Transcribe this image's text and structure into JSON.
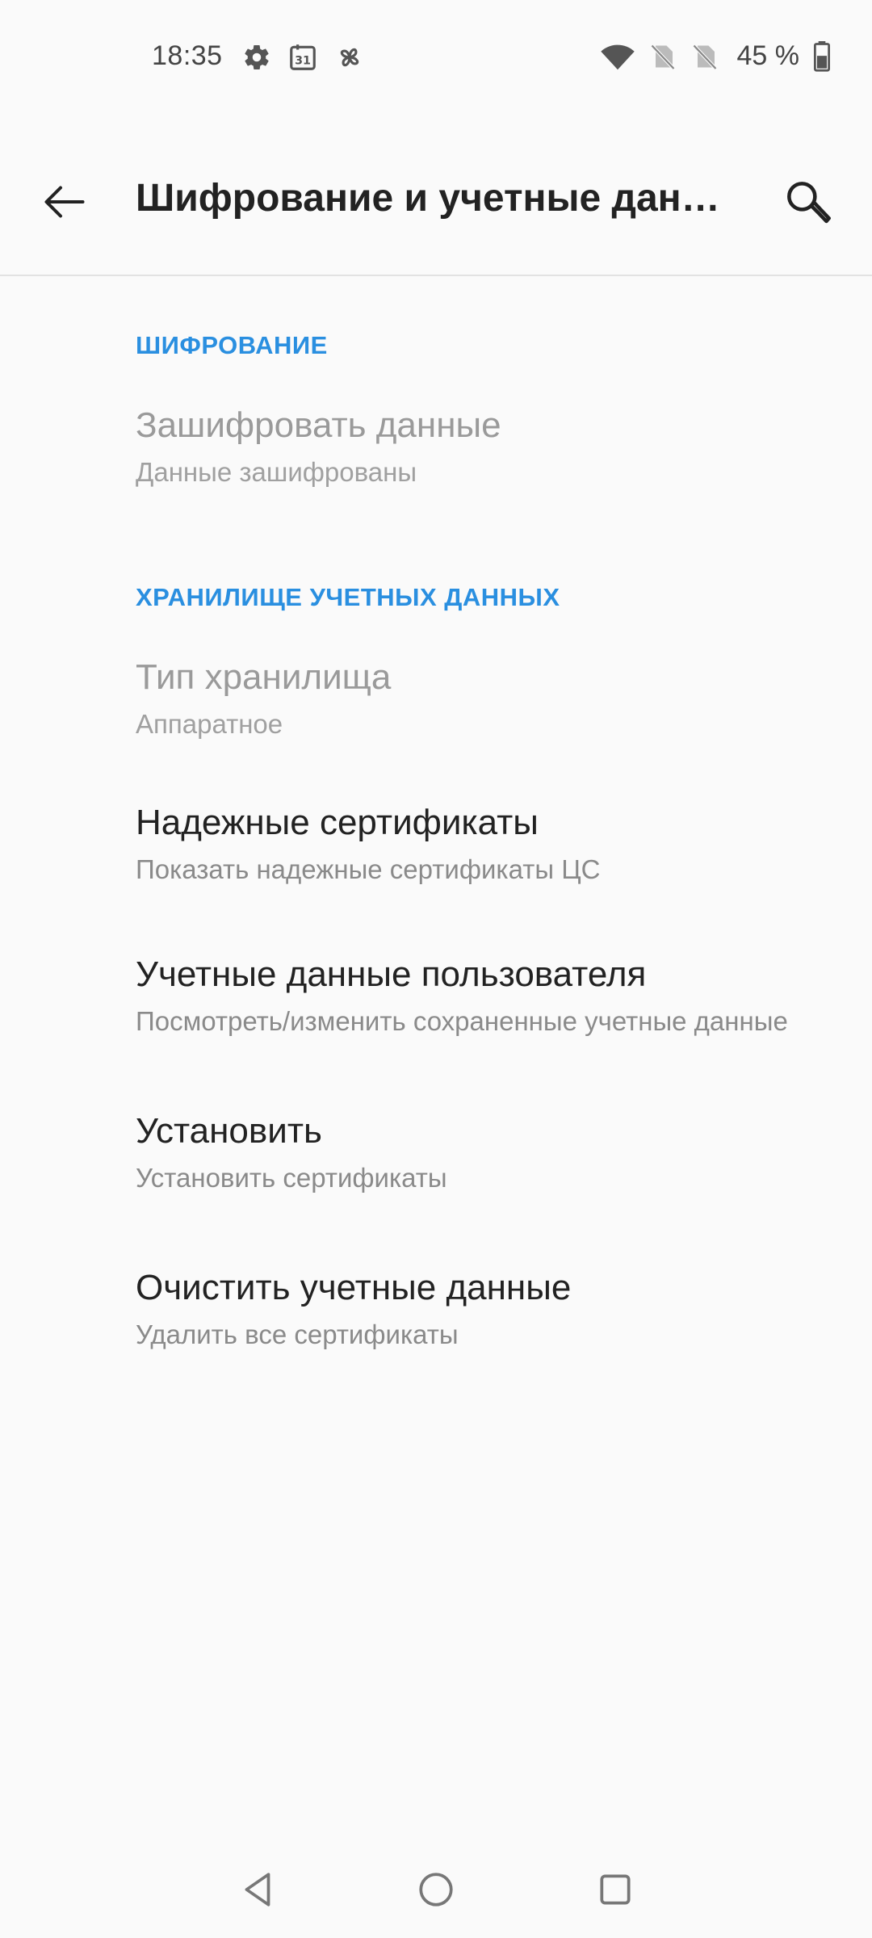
{
  "status_bar": {
    "time": "18:35",
    "calendar_day": "31",
    "battery": "45 %"
  },
  "app_bar": {
    "title": "Шифрование и учетные данн…"
  },
  "sections": {
    "encryption": {
      "header": "ШИФРОВАНИЕ",
      "encrypt_data": {
        "title": "Зашифровать данные",
        "summary": "Данные зашифрованы"
      }
    },
    "credential_storage": {
      "header": "ХРАНИЛИЩЕ УЧЕТНЫХ ДАННЫХ",
      "storage_type": {
        "title": "Тип хранилища",
        "summary": "Аппаратное"
      },
      "trusted_certs": {
        "title": "Надежные сертификаты",
        "summary": "Показать надежные сертификаты ЦС"
      },
      "user_credentials": {
        "title": "Учетные данные пользователя",
        "summary": "Посмотреть/изменить сохраненные учетные данные"
      },
      "install": {
        "title": "Установить",
        "summary": "Установить сертификаты"
      },
      "clear": {
        "title": "Очистить учетные данные",
        "summary": "Удалить все сертификаты"
      }
    }
  },
  "colors": {
    "accent": "#2a8fe0",
    "background": "#fafafa",
    "title_text": "#222222",
    "summary_text": "#8a8a8a"
  },
  "icons": {
    "back": "arrow-left-icon",
    "search": "search-icon",
    "nav_back": "triangle-back-icon",
    "nav_home": "circle-home-icon",
    "nav_recents": "square-recents-icon"
  }
}
